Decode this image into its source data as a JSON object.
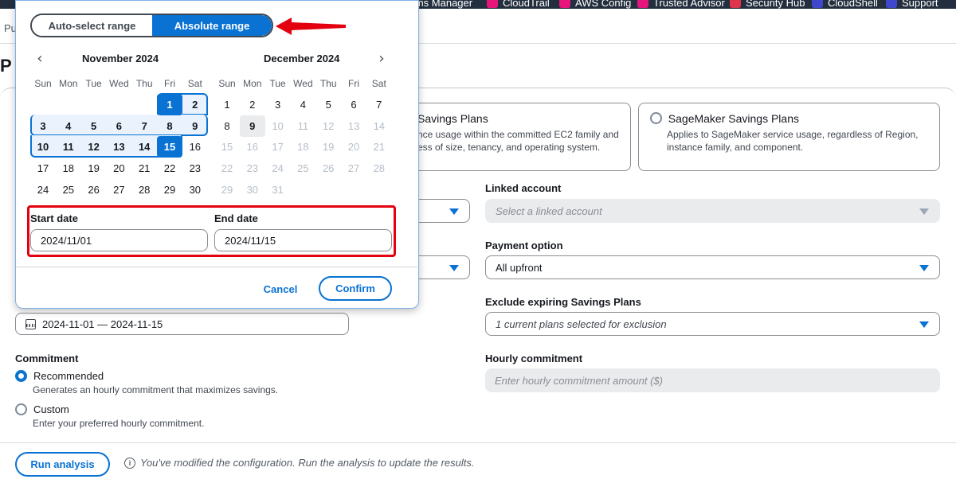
{
  "nav": {
    "services": [
      {
        "label": "tems Manager",
        "icon": "systems-manager-icon",
        "color": "#c925d1"
      },
      {
        "label": "CloudTrail",
        "icon": "cloudtrail-icon",
        "color": "#e7157b"
      },
      {
        "label": "AWS Config",
        "icon": "aws-config-icon",
        "color": "#e7157b"
      },
      {
        "label": "Trusted Advisor",
        "icon": "trusted-advisor-icon",
        "color": "#e7157b"
      },
      {
        "label": "Security Hub",
        "icon": "security-hub-icon",
        "color": "#dd344c"
      },
      {
        "label": "CloudShell",
        "icon": "cloudshell-icon",
        "color": "#3f48cc"
      },
      {
        "label": "Support",
        "icon": "support-icon",
        "color": "#3f48cc"
      }
    ]
  },
  "breadcrumb": "Pu",
  "page_title": "P",
  "plans": {
    "ec2": {
      "title": "Savings Plans",
      "desc_line1": "nce usage within the committed EC2 family and",
      "desc_line2": "ess of size, tenancy, and operating system."
    },
    "sagemaker": {
      "title": "SageMaker Savings Plans",
      "desc_line1": "Applies to SageMaker service usage, regardless of Region,",
      "desc_line2": "instance family, and component."
    }
  },
  "form": {
    "linked_account": {
      "label": "Linked account",
      "placeholder": "Select a linked account"
    },
    "payment_option": {
      "label": "Payment option",
      "value": "All upfront"
    },
    "exclude_expiring": {
      "label": "Exclude expiring Savings Plans",
      "value": "1 current plans selected for exclusion"
    },
    "hourly_commitment": {
      "label": "Hourly commitment",
      "placeholder": "Enter hourly commitment amount ($)"
    },
    "date_range_value": "2024-11-01 — 2024-11-15",
    "commitment": {
      "label": "Commitment",
      "options": [
        {
          "label": "Recommended",
          "desc": "Generates an hourly commitment that maximizes savings.",
          "selected": true
        },
        {
          "label": "Custom",
          "desc": "Enter your preferred hourly commitment.",
          "selected": false
        }
      ]
    }
  },
  "footer": {
    "run_button": "Run analysis",
    "info_icon": "i",
    "note": "You've modified the configuration. Run the analysis to update the results."
  },
  "picker": {
    "tabs": {
      "auto": "Auto-select range",
      "absolute": "Absolute range",
      "active": "absolute"
    },
    "prev_icon": "‹",
    "next_icon": "›",
    "weekdays": [
      "Sun",
      "Mon",
      "Tue",
      "Wed",
      "Thu",
      "Fri",
      "Sat"
    ],
    "months": [
      {
        "title": "November 2024",
        "first_weekday": 5,
        "days": 30,
        "disabled_after": 31
      },
      {
        "title": "December 2024",
        "first_weekday": 0,
        "days": 31,
        "disabled_after": 9
      }
    ],
    "range_start": {
      "month": 0,
      "day": 1
    },
    "range_end": {
      "month": 0,
      "day": 15
    },
    "today": {
      "month": 1,
      "day": 9
    },
    "start_label": "Start date",
    "end_label": "End date",
    "start_value": "2024/11/01",
    "end_value": "2024/11/15",
    "cancel": "Cancel",
    "confirm": "Confirm"
  },
  "colors": {
    "accent": "#0972d3",
    "highlight": "#e3000f",
    "nav_bg": "#232f3e"
  }
}
